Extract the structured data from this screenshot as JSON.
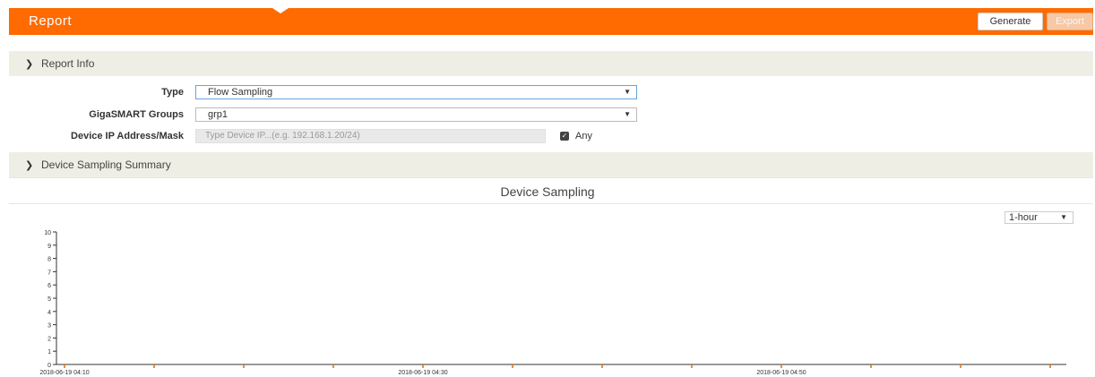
{
  "header": {
    "title": "Report",
    "generate_label": "Generate",
    "export_label": "Export",
    "accent_color": "#ff6b00"
  },
  "report_info": {
    "section_label": "Report Info",
    "type_label": "Type",
    "type_value": "Flow Sampling",
    "groups_label": "GigaSMART Groups",
    "groups_value": "grp1",
    "device_ip_label": "Device IP Address/Mask",
    "device_ip_placeholder": "Type Device IP...(e.g. 192.168.1.20/24)",
    "any_label": "Any",
    "any_checked": true
  },
  "summary": {
    "section_label": "Device Sampling Summary"
  },
  "chart_data": {
    "type": "line",
    "title": "Device Sampling",
    "range_select": "1-hour",
    "ylim": [
      0,
      10
    ],
    "y_ticks": [
      "0",
      "1",
      "2",
      "3",
      "4",
      "5",
      "6",
      "7",
      "8",
      "9",
      "10"
    ],
    "x_tick_labels": [
      "2018-06-19 04:10",
      "2018-06-19 04:30",
      "2018-06-19 04:50"
    ],
    "x_tick_count": 12,
    "series": []
  }
}
